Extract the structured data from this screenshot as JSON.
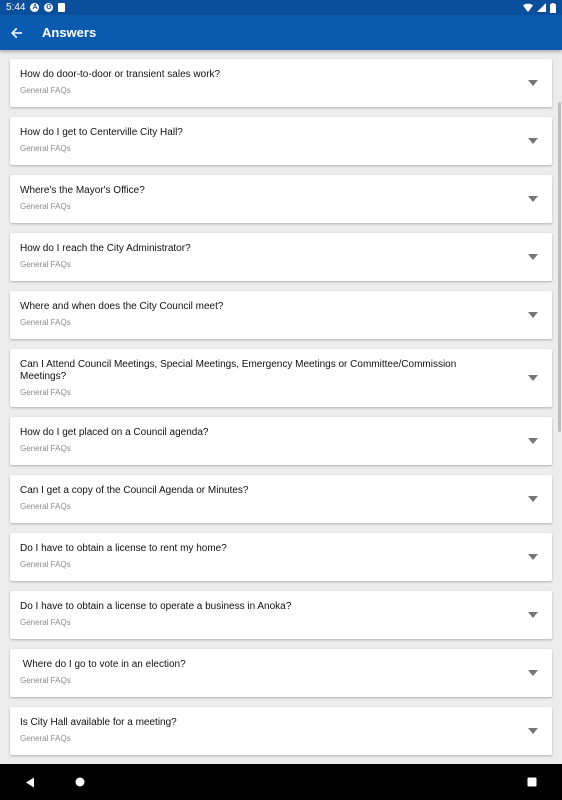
{
  "status_bar": {
    "time": "5:44",
    "icons": [
      "app-notification-icon",
      "app-notification-icon-2",
      "sd-card-icon"
    ],
    "right_icons": [
      "wifi-icon",
      "signal-icon",
      "battery-icon"
    ]
  },
  "app_bar": {
    "title": "Answers",
    "back_icon": "arrow-back-icon"
  },
  "faqs": [
    {
      "question": "How do door-to-door or transient sales work?",
      "category": "General FAQs"
    },
    {
      "question": "How do I get to Centerville City Hall?",
      "category": "General FAQs"
    },
    {
      "question": "Where's the Mayor's Office?",
      "category": "General FAQs"
    },
    {
      "question": "How do I reach the City Administrator?",
      "category": "General FAQs"
    },
    {
      "question": "Where and when does the City Council meet?",
      "category": "General FAQs"
    },
    {
      "question": "Can I Attend Council Meetings, Special Meetings, Emergency Meetings or Committee/Commission Meetings?",
      "category": "General FAQs"
    },
    {
      "question": "How do I get placed on a Council agenda?",
      "category": "General FAQs"
    },
    {
      "question": "Can I get a copy of the Council Agenda or Minutes?",
      "category": "General FAQs"
    },
    {
      "question": "Do I have to obtain a license to rent my home?",
      "category": "General FAQs"
    },
    {
      "question": "Do I have to obtain a license to operate a business in Anoka?",
      "category": "General FAQs"
    },
    {
      "question": " Where do I go to vote in an election?",
      "category": "General FAQs"
    },
    {
      "question": "Is City Hall available for a meeting?",
      "category": "General FAQs"
    }
  ],
  "nav_bar": {
    "icons": [
      "back-triangle-icon",
      "home-circle-icon",
      "recents-square-icon"
    ]
  },
  "colors": {
    "app_bar": "#0a5bb0",
    "status_bar": "#0a4f9c",
    "background": "#ececec"
  }
}
